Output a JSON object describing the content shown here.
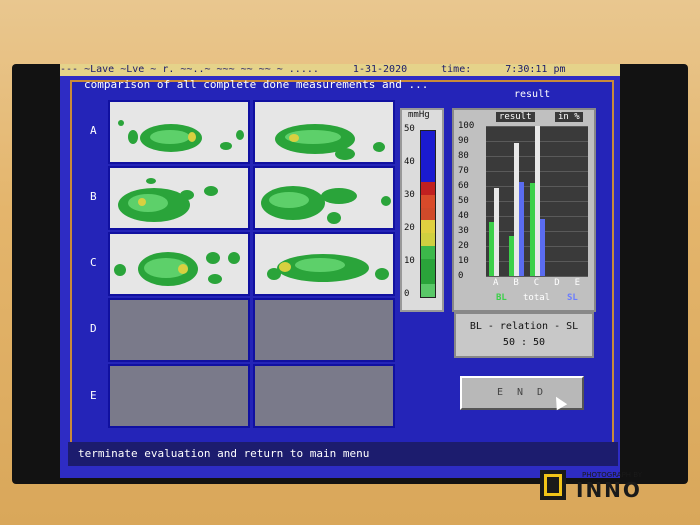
{
  "window": {
    "topbar_text": [
      " --- ~Lave  ~Lve ~  r.  ~~..~ ~~~ ~~ ~~ ~ .....",
      "1-31-2020",
      "time:",
      "7:30:11 pm"
    ],
    "header_title": "comparison of all complete done measurements and ...",
    "header_right": "result"
  },
  "rows": [
    "A",
    "B",
    "C",
    "D",
    "E"
  ],
  "scale": {
    "unit": "mmHg",
    "ticks": [
      "50",
      "40",
      "30",
      "20",
      "10",
      "0"
    ],
    "colors": [
      "#1a1ad0",
      "#1a1ad0",
      "#1a1ad0",
      "#1a1ad0",
      "#c02020",
      "#d84a2a",
      "#d04a2a",
      "#e0d040",
      "#d0d040",
      "#3cb84a",
      "#2aa43a",
      "#2aa43a",
      "#5ac868"
    ]
  },
  "result_panel": {
    "title": "result",
    "unit": "in %",
    "y_ticks": [
      "100",
      "90",
      "80",
      "70",
      "60",
      "50",
      "40",
      "30",
      "20",
      "10",
      "0"
    ],
    "categories": [
      "A",
      "B",
      "C",
      "D",
      "E"
    ],
    "legend_bl": "BL",
    "legend_total": "total",
    "legend_sl": "SL"
  },
  "chart_data": {
    "type": "bar",
    "title": "result",
    "ylabel": "in %",
    "ylim": [
      0,
      100
    ],
    "categories": [
      "A",
      "B",
      "C",
      "D",
      "E"
    ],
    "series": [
      {
        "name": "BL",
        "values": [
          36,
          27,
          62,
          0,
          0
        ]
      },
      {
        "name": "total",
        "values": [
          59,
          89,
          100,
          0,
          0
        ]
      },
      {
        "name": "SL",
        "values": [
          0,
          63,
          38,
          0,
          0
        ]
      }
    ],
    "series_colors": {
      "BL": "#3cd04a",
      "total": "#e8e8e8",
      "SL": "#5a6cf0"
    }
  },
  "relation": {
    "label": "BL - relation - SL",
    "value": "50 :  50"
  },
  "end_button": {
    "label": "E N D"
  },
  "statusbar": {
    "text": "terminate evaluation and return to main menu"
  },
  "watermark": {
    "small": "PHOTOGRAPH BY",
    "big": "INNO"
  }
}
